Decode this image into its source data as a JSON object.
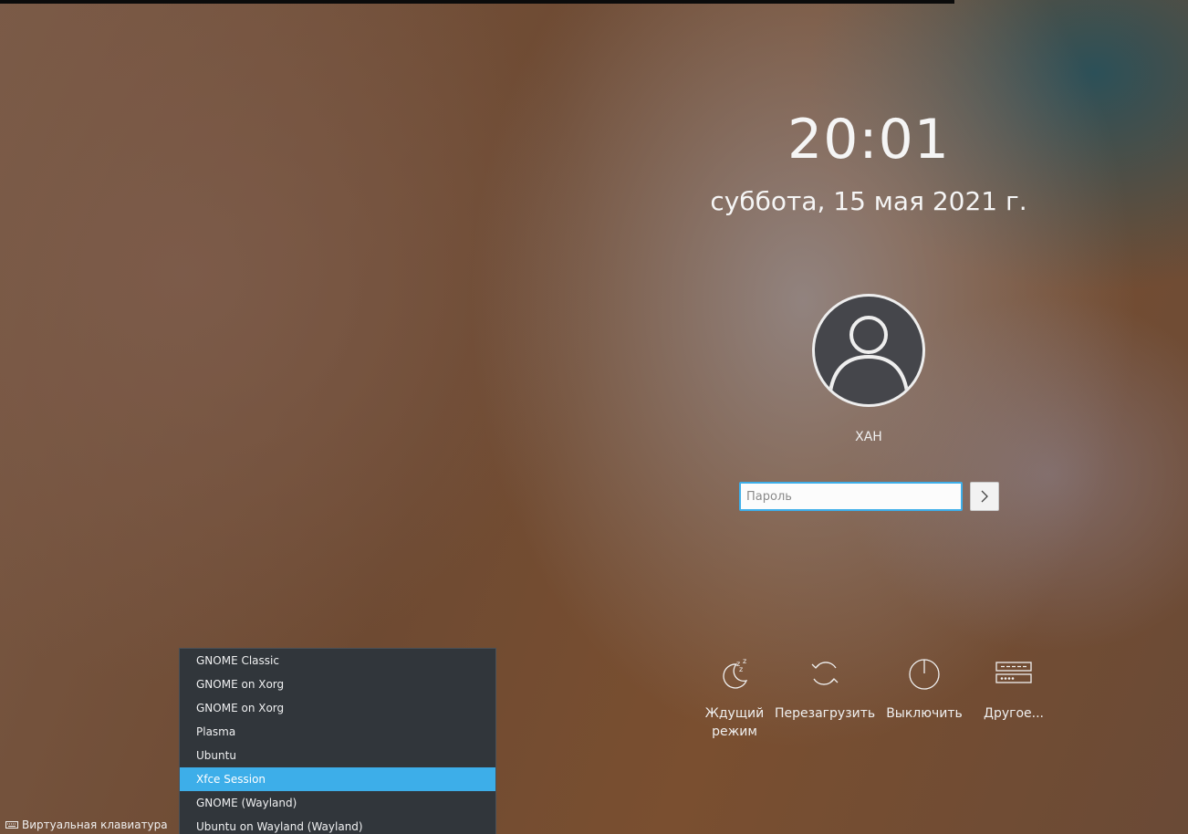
{
  "clock": {
    "time": "20:01",
    "date": "суббота, 15 мая 2021 г."
  },
  "user": {
    "name": "XAH"
  },
  "password": {
    "placeholder": "Пароль",
    "value": ""
  },
  "login_button": {
    "icon": "chevron-right-icon"
  },
  "actions": [
    {
      "label": "Ждущий режим",
      "icon": "sleep-icon"
    },
    {
      "label": "Перезагрузить",
      "icon": "restart-icon"
    },
    {
      "label": "Выключить",
      "icon": "power-icon"
    },
    {
      "label": "Другое...",
      "icon": "switch-user-icon"
    }
  ],
  "session_menu": {
    "items": [
      "GNOME Classic",
      "GNOME on Xorg",
      "GNOME on Xorg",
      "Plasma",
      "Ubuntu",
      "Xfce Session",
      "GNOME (Wayland)",
      "Ubuntu on Wayland (Wayland)"
    ],
    "selected": "Xfce Session"
  },
  "virtual_keyboard": {
    "label": "Виртуальная клавиатура",
    "icon": "keyboard-icon"
  },
  "colors": {
    "accent": "#3daee9",
    "menu_bg": "#31363b"
  }
}
